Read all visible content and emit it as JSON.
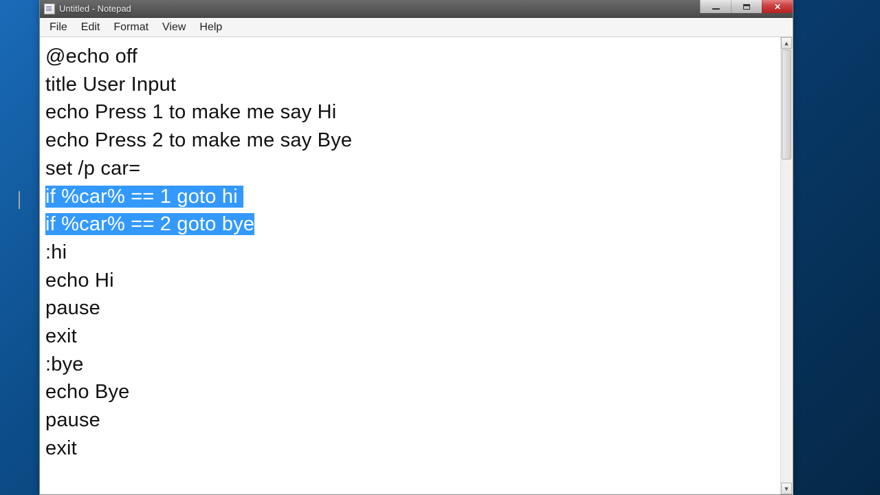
{
  "window": {
    "title": "Untitled - Notepad"
  },
  "menu": {
    "file": "File",
    "edit": "Edit",
    "format": "Format",
    "view": "View",
    "help": "Help"
  },
  "editor": {
    "lines": [
      "@echo off",
      "title User Input",
      "echo Press 1 to make me say Hi",
      "echo Press 2 to make me say Bye",
      "set /p car=",
      "if %car% == 1 goto hi ",
      "if %car% == 2 goto bye",
      ":hi",
      "echo Hi",
      "pause",
      "exit",
      ":bye",
      "echo Bye",
      "pause",
      "exit"
    ],
    "selected_line_indexes": [
      5,
      6
    ]
  },
  "colors": {
    "selection_bg": "#3399ff",
    "selection_fg": "#ffffff"
  }
}
